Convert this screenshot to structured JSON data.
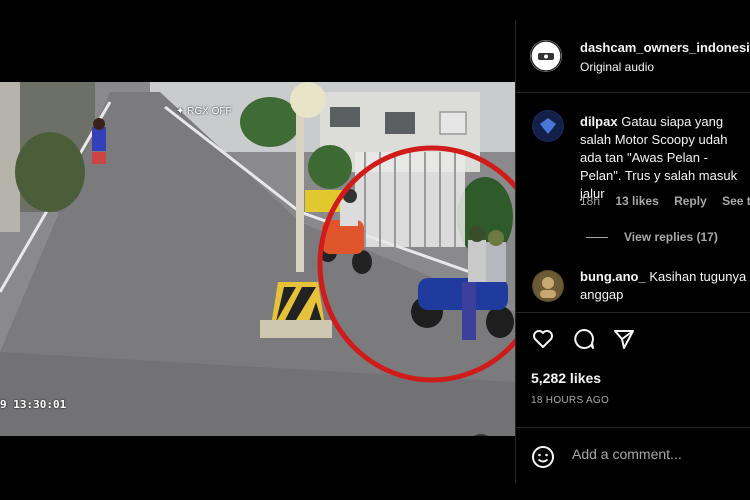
{
  "video": {
    "rgx_label": "RGX OFF",
    "timestamp": "9 13:30:01",
    "mute_icon": "speaker-muted-icon"
  },
  "post": {
    "author": "dashcam_owners_indonesia",
    "audio": "Original audio"
  },
  "comments": [
    {
      "user": "dilpax",
      "text": "Gatau siapa yang salah Motor Scoopy udah ada tan \"Awas Pelan - Pelan\". Trus y salah masuk jalur",
      "age": "18h",
      "likes": "13 likes",
      "reply": "Reply",
      "see": "See transl",
      "view_replies": "View replies (17)"
    },
    {
      "user": "bung.ano_",
      "text": "Kasihan tugunya anggap"
    }
  ],
  "stats": {
    "likes": "5,282 likes",
    "time": "18 HOURS AGO"
  },
  "composer": {
    "placeholder": "Add a comment..."
  },
  "colors": {
    "annotation_circle": "#d11a1a",
    "background": "#000000",
    "muted_text": "#a8a8a8"
  }
}
